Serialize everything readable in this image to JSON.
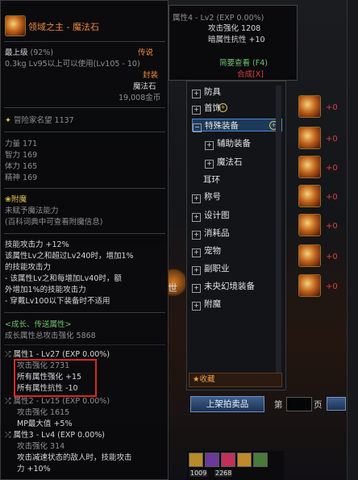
{
  "tooltip": {
    "title": "领域之主 - 魔法石",
    "level_label": "最上级",
    "level_pct": "(92%)",
    "rarity": "传说",
    "weight_level": "0.3kg  Lv95以上可以使用(Lv105 - 10)",
    "bound": "封装",
    "type": "魔法石",
    "price": "19,008金币",
    "adventurer": "冒险家名望 1137",
    "stats": [
      "力量 171",
      "智力 169",
      "体力 165",
      "精神 169"
    ],
    "enchant_title": "附魔",
    "enchant_line1": "未赋予魔法能力",
    "enchant_line2": "(百科词典中可查看附魔信息)",
    "skill_lines": [
      "技能攻击力 +12%",
      "该属性Lv之和超过Lv240时，增加1%",
      "的技能攻击力",
      "- 该属性Lv之和每增加Lv40时，额",
      "外增加1%的技能攻击力",
      "- 穿戴Lv100以下装备时不适用"
    ],
    "growth_title": "<成长、传送属性>",
    "growth_total": "成长属性总攻击强化 5868",
    "attr1_head": "属性1 - Lv27 (EXP 0.00%)",
    "attr1_lines": [
      "攻击强化 2731",
      "所有属性强化 +15",
      "所有属性抗性 -10"
    ],
    "attr2_head": "属性2 - Lv15 (EXP 0.00%)",
    "attr2_lines": [
      "攻击强化 1615",
      "MP最大值 +5%"
    ],
    "attr3_head": "属性3 - Lv4 (EXP 0.00%)",
    "attr3_lines": [
      "攻击强化 314",
      "攻击减速状态的敌人时，技能攻击",
      "力 +10%"
    ]
  },
  "tooltip2": {
    "head": "属性4 - Lv2 (EXP 0.00%)",
    "line1": "攻击强化 1208",
    "line2": "暗属性抗性 +10",
    "brief": "简要查看 (F4)",
    "compose": "合成[X]"
  },
  "categories": [
    {
      "label": "防具",
      "box": "+"
    },
    {
      "label": "首饰",
      "box": "+"
    },
    {
      "label": "特殊装备",
      "box": "−"
    },
    {
      "label": "辅助装备",
      "box": "+"
    },
    {
      "label": "魔法石",
      "box": "+"
    },
    {
      "label": "耳环",
      "box": ""
    },
    {
      "label": "称号",
      "box": "+"
    },
    {
      "label": "设计图",
      "box": "+"
    },
    {
      "label": "消耗品",
      "box": "+"
    },
    {
      "label": "宠物",
      "box": "+"
    },
    {
      "label": "副职业",
      "box": "+"
    },
    {
      "label": "未央幻境装备",
      "box": "+"
    },
    {
      "label": "附魔",
      "box": "+"
    }
  ],
  "favorites": "★收藏",
  "list_plus": [
    "+0",
    "+0",
    "+0",
    "+0",
    "+0",
    "+0",
    "+0"
  ],
  "bottom": {
    "list_button": "上架拍卖品",
    "page_left": "第",
    "page_right": "页"
  },
  "hotbar": {
    "n1": "1009",
    "n2": "2268"
  },
  "scene_word": "世"
}
